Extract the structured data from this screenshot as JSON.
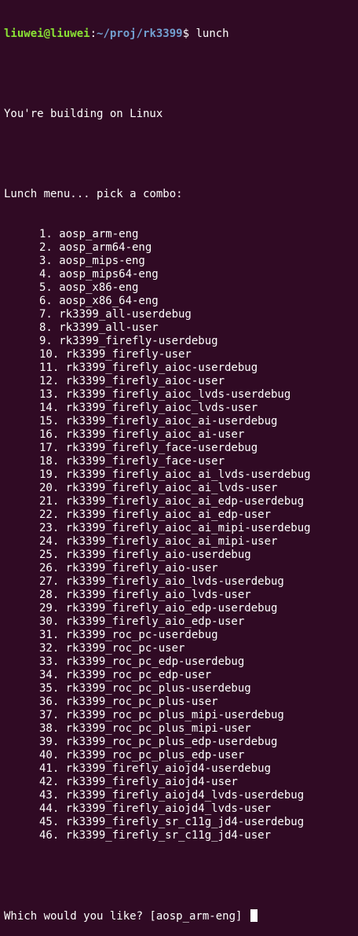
{
  "prompt": {
    "user_host": "liuwei@liuwei",
    "separator": ":",
    "path": "~/proj/rk3399",
    "symbol": "$",
    "command": " lunch"
  },
  "build_message": "You're building on Linux",
  "menu_header": "Lunch menu... pick a combo:",
  "menu_items": [
    "1. aosp_arm-eng",
    "2. aosp_arm64-eng",
    "3. aosp_mips-eng",
    "4. aosp_mips64-eng",
    "5. aosp_x86-eng",
    "6. aosp_x86_64-eng",
    "7. rk3399_all-userdebug",
    "8. rk3399_all-user",
    "9. rk3399_firefly-userdebug",
    "10. rk3399_firefly-user",
    "11. rk3399_firefly_aioc-userdebug",
    "12. rk3399_firefly_aioc-user",
    "13. rk3399_firefly_aioc_lvds-userdebug",
    "14. rk3399_firefly_aioc_lvds-user",
    "15. rk3399_firefly_aioc_ai-userdebug",
    "16. rk3399_firefly_aioc_ai-user",
    "17. rk3399_firefly_face-userdebug",
    "18. rk3399_firefly_face-user",
    "19. rk3399_firefly_aioc_ai_lvds-userdebug",
    "20. rk3399_firefly_aioc_ai_lvds-user",
    "21. rk3399_firefly_aioc_ai_edp-userdebug",
    "22. rk3399_firefly_aioc_ai_edp-user",
    "23. rk3399_firefly_aioc_ai_mipi-userdebug",
    "24. rk3399_firefly_aioc_ai_mipi-user",
    "25. rk3399_firefly_aio-userdebug",
    "26. rk3399_firefly_aio-user",
    "27. rk3399_firefly_aio_lvds-userdebug",
    "28. rk3399_firefly_aio_lvds-user",
    "29. rk3399_firefly_aio_edp-userdebug",
    "30. rk3399_firefly_aio_edp-user",
    "31. rk3399_roc_pc-userdebug",
    "32. rk3399_roc_pc-user",
    "33. rk3399_roc_pc_edp-userdebug",
    "34. rk3399_roc_pc_edp-user",
    "35. rk3399_roc_pc_plus-userdebug",
    "36. rk3399_roc_pc_plus-user",
    "37. rk3399_roc_pc_plus_mipi-userdebug",
    "38. rk3399_roc_pc_plus_mipi-user",
    "39. rk3399_roc_pc_plus_edp-userdebug",
    "40. rk3399_roc_pc_plus_edp-user",
    "41. rk3399_firefly_aiojd4-userdebug",
    "42. rk3399_firefly_aiojd4-user",
    "43. rk3399_firefly_aiojd4_lvds-userdebug",
    "44. rk3399_firefly_aiojd4_lvds-user",
    "45. rk3399_firefly_sr_c11g_jd4-userdebug",
    "46. rk3399_firefly_sr_c11g_jd4-user"
  ],
  "question": "Which would you like? [aosp_arm-eng] ",
  "colors": {
    "background": "#300a24",
    "text": "#ffffff",
    "user_host": "#8ae234",
    "path": "#729fcf"
  }
}
